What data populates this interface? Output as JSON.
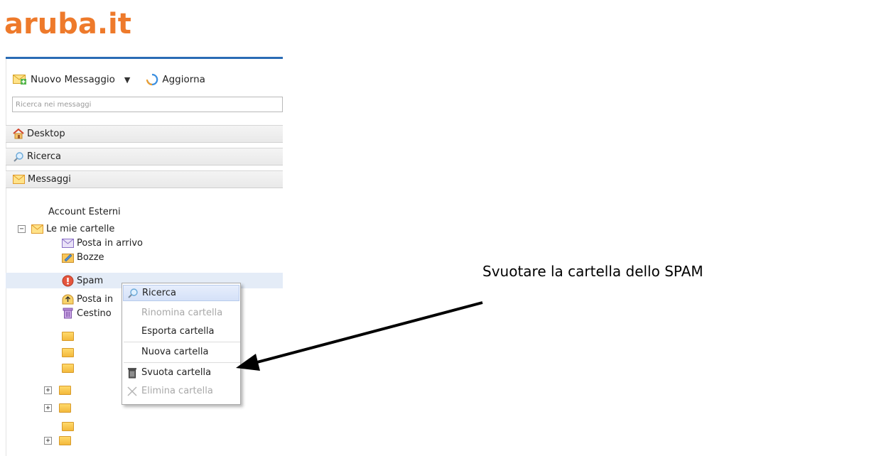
{
  "app": {
    "logo_text": "aruba.it",
    "colors": {
      "logo": "#ee7a2b",
      "accent": "#2a6cb5",
      "selection": "#e4ecf7"
    }
  },
  "toolbar": {
    "new_message_label": "Nuovo Messaggio",
    "new_message_icon": "new-message-icon",
    "refresh_label": "Aggiorna",
    "refresh_icon": "refresh-icon"
  },
  "search": {
    "placeholder": "Ricerca nei messaggi",
    "value": ""
  },
  "sections": [
    {
      "label": "Desktop",
      "icon": "home-icon"
    },
    {
      "label": "Ricerca",
      "icon": "search-icon"
    },
    {
      "label": "Messaggi",
      "icon": "envelope-icon"
    }
  ],
  "tree": {
    "external_accounts": "Account Esterni",
    "my_folders": "Le mie cartelle",
    "folders": [
      {
        "label": "Posta in arrivo",
        "icon": "inbox-icon"
      },
      {
        "label": "Bozze",
        "icon": "drafts-icon"
      },
      {
        "label": "Spam",
        "icon": "spam-icon",
        "selected": true
      },
      {
        "label": "Posta in",
        "icon": "outbox-icon"
      },
      {
        "label": "Cestino",
        "icon": "trash-icon"
      }
    ]
  },
  "context_menu": {
    "items": [
      {
        "label": "Ricerca",
        "icon": "search-icon",
        "enabled": true,
        "highlighted": true
      },
      {
        "label": "Rinomina cartella",
        "enabled": false
      },
      {
        "label": "Esporta cartella",
        "enabled": true
      },
      {
        "label": "Nuova cartella",
        "enabled": true
      },
      {
        "label": "Svuota cartella",
        "icon": "trash-icon",
        "enabled": true
      },
      {
        "label": "Elimina cartella",
        "icon": "delete-x-icon",
        "enabled": false
      }
    ]
  },
  "annotation": {
    "text": "Svuotare la cartella dello SPAM"
  }
}
